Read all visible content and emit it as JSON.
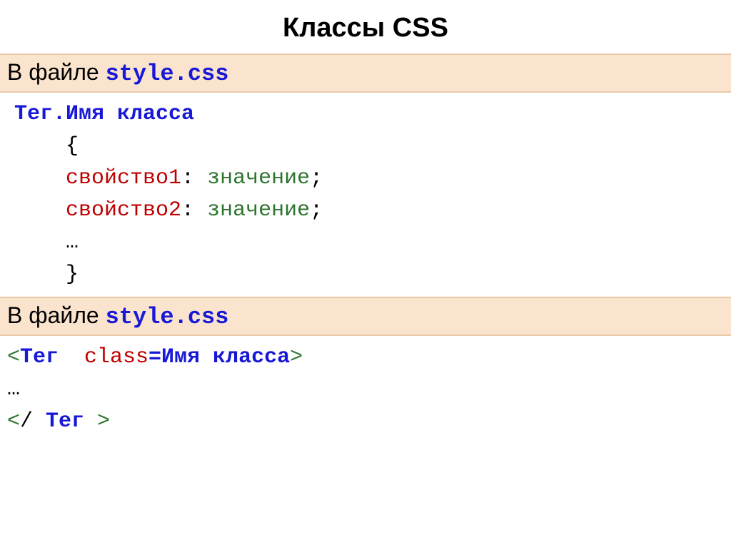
{
  "title": "Классы CSS",
  "section1": {
    "prefix": "В файле ",
    "filename": "style.css"
  },
  "code1": {
    "selector": "Тег.Имя класса",
    "open_brace": "    {",
    "prop1_name": "свойство1",
    "colon": ":",
    "prop1_val": " значение",
    "semi": ";",
    "prop2_name": "свойство2",
    "prop2_val": " значение",
    "ellipsis": "    …",
    "close_brace": "    }",
    "indent": "    "
  },
  "section2": {
    "prefix": "В файле ",
    "filename": "style.css"
  },
  "code2": {
    "lt": "<",
    "tag_open": "Тег  ",
    "attr_name": "class",
    "eq_val": "=Имя класса",
    "gt": ">",
    "ellipsis": "…",
    "close_lt": "<",
    "close_slash": "/",
    "close_tag": " Тег ",
    "close_gt": ">"
  }
}
